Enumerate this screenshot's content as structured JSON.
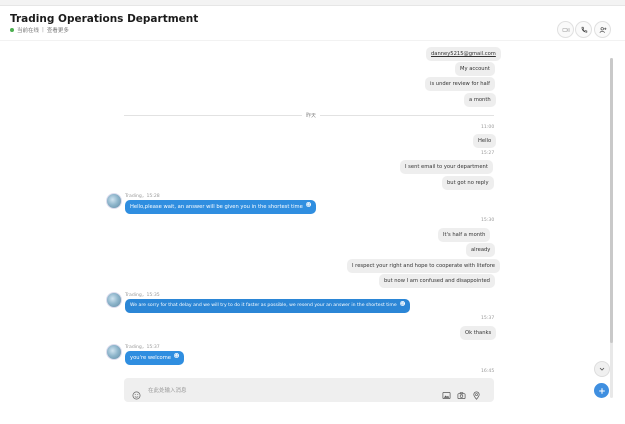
{
  "header": {
    "title": "Trading Operations Department",
    "status": "当前在线",
    "sep": "|",
    "sub_link": "查看更多"
  },
  "messages": {
    "email": "danney5215@gmail.com",
    "m1": "My account",
    "m2": "is under review for half",
    "m3": "a month",
    "divider": "昨天",
    "t1": "11:00",
    "m4": "Hello",
    "t2": "15:27",
    "m5": "I sent email to your department",
    "m6": "but got no reply",
    "s1": "Trading，15:28",
    "r1": "Hello,please wait, an answer will be given you in the shortest time",
    "t3": "15:30",
    "m7": "It's half a month",
    "m8": "already",
    "m9": "I respect your right and hope to cooperate with litefore",
    "m10": "but now I am confused and disappointed",
    "s2": "Trading，15:35",
    "r2": "We are sorry for that delay and we will try to do it faster as possible, we resend your an answer in the shortest time",
    "t4": "15:37",
    "m11": "Ok thanks",
    "s3": "Trading，15:37",
    "r3": "you're welcome",
    "t5": "16:45"
  },
  "composer": {
    "placeholder": "在此处输入消息"
  },
  "icons": [
    "video-icon",
    "phone-icon",
    "add-person-icon",
    "emoji-icon",
    "image-icon",
    "camera-icon",
    "location-icon",
    "chevron-down-icon",
    "plus-icon"
  ],
  "colors": {
    "accent": "#2f8ee0",
    "online": "#4caf50"
  }
}
